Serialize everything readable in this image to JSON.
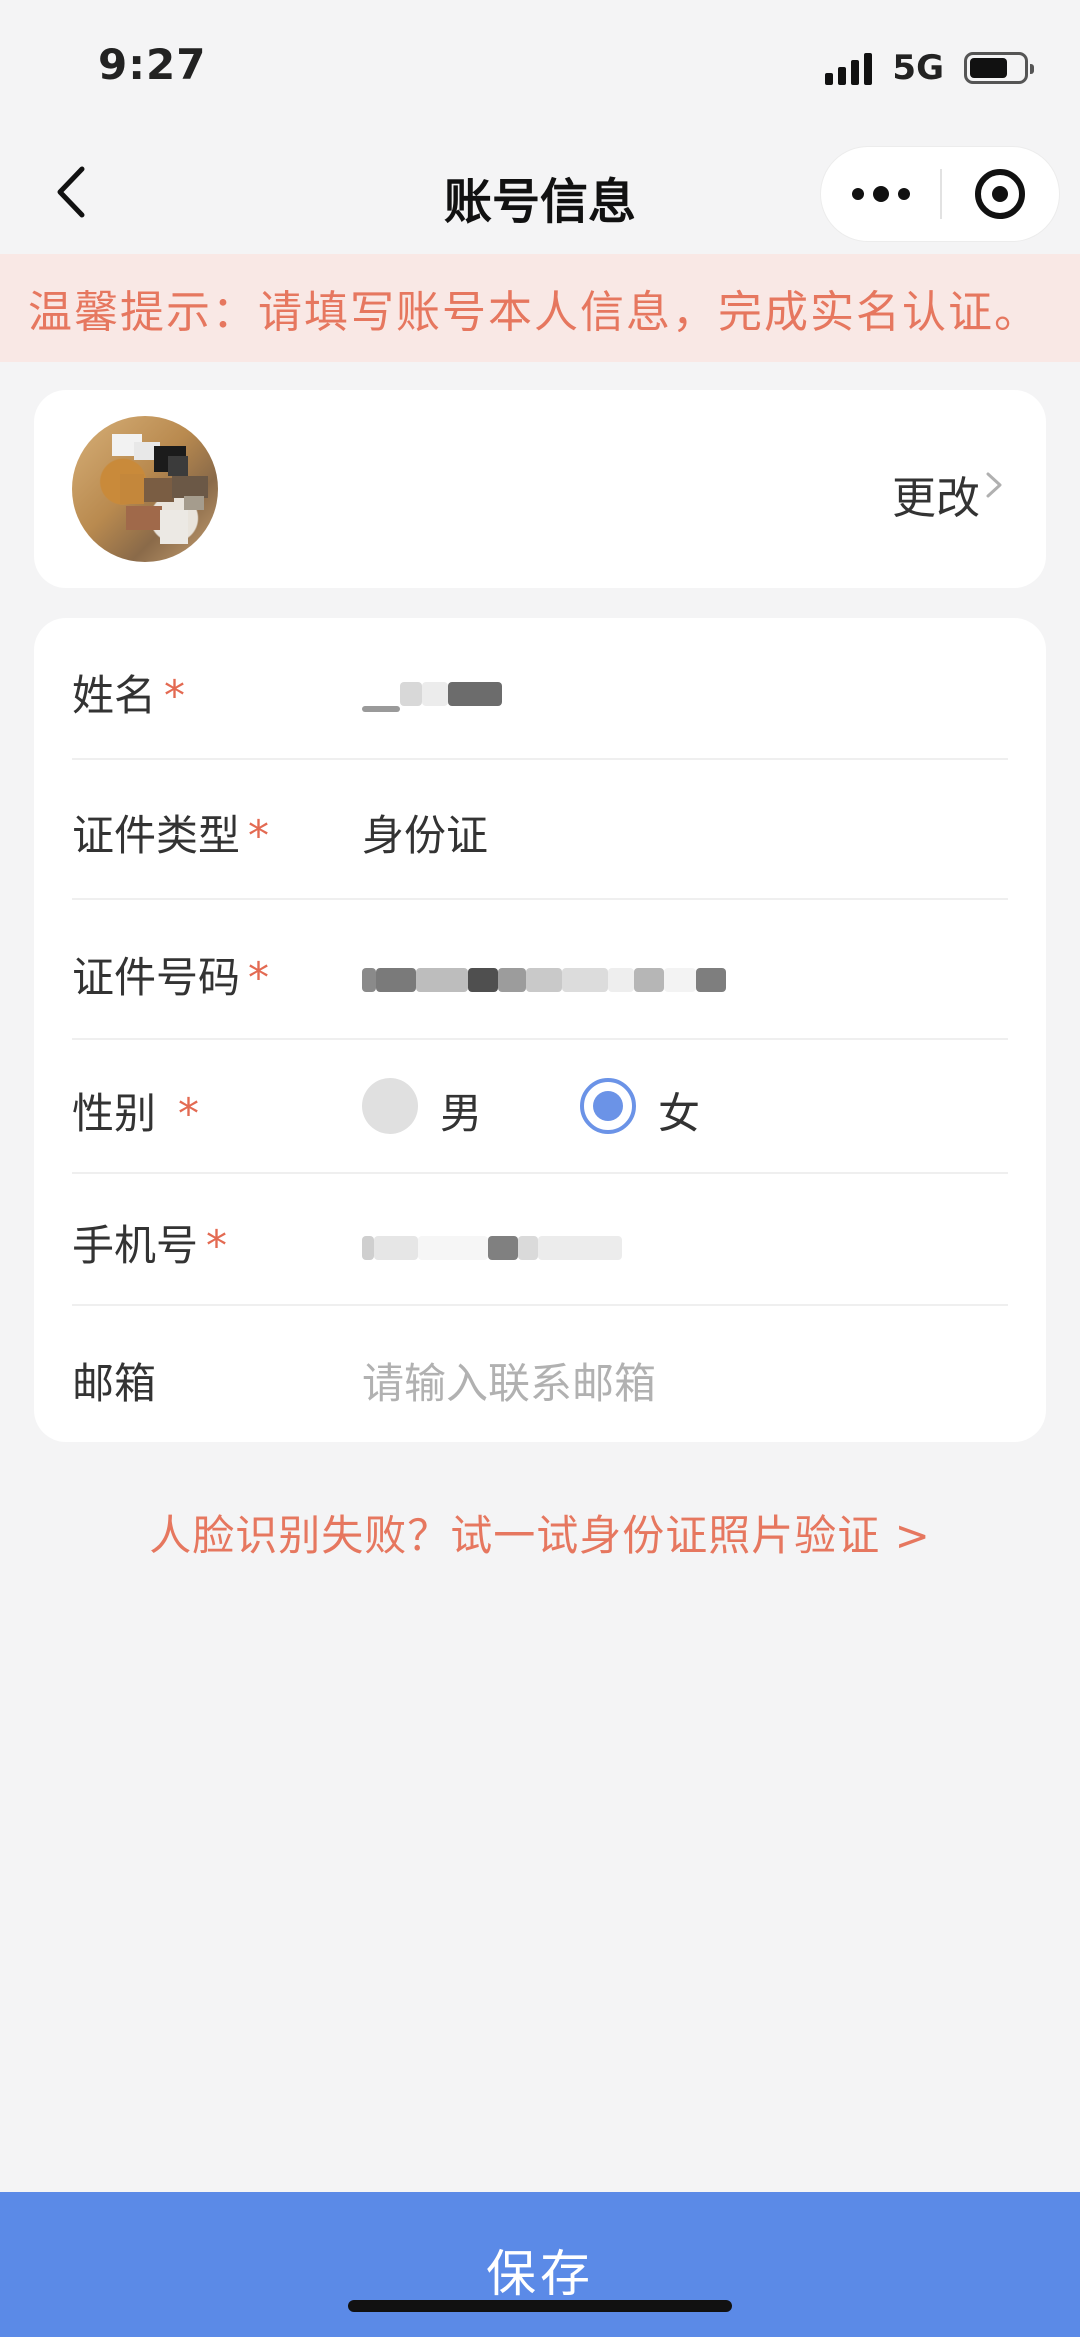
{
  "status_bar": {
    "time": "9:27",
    "network": "5G",
    "signal_bars": 4,
    "battery_level": 0.72
  },
  "nav": {
    "title": "账号信息",
    "back_icon": "chevron-left-icon",
    "more_icon": "more-dots-icon",
    "close_icon": "target-close-icon"
  },
  "notice": {
    "text": "温馨提示：请填写账号本人信息，完成实名认证。"
  },
  "avatar_section": {
    "change_label": "更改",
    "chevron_icon": "chevron-right-icon"
  },
  "form": {
    "required_mark": "*",
    "name": {
      "label": "姓名"
    },
    "id_type": {
      "label": "证件类型",
      "value": "身份证"
    },
    "id_number": {
      "label": "证件号码"
    },
    "gender": {
      "label": "性别",
      "options": [
        "男",
        "女"
      ],
      "selected": "女"
    },
    "phone": {
      "label": "手机号"
    },
    "email": {
      "label": "邮箱",
      "placeholder": "请输入联系邮箱"
    }
  },
  "face_link": {
    "text": "人脸识别失败？试一试身份证照片验证 >"
  },
  "footer": {
    "save_label": "保存"
  },
  "colors": {
    "accent_blue": "#5b8ae7",
    "notice_text": "#e6775f",
    "notice_bg": "#f9e8e5",
    "required": "#e36a52",
    "page_bg": "#f4f4f5"
  }
}
